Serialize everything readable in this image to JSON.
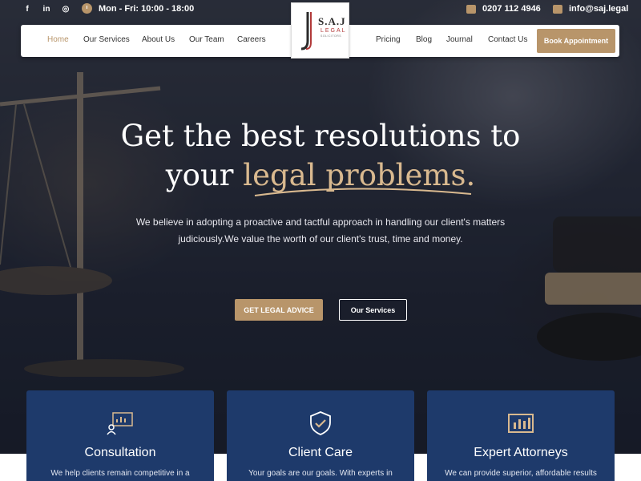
{
  "topbar": {
    "hours": "Mon - Fri: 10:00 - 18:00",
    "phone": "0207 112 4946",
    "email": "info@saj.legal",
    "social": [
      "facebook-icon",
      "linkedin-icon",
      "instagram-icon"
    ]
  },
  "logo": {
    "name": "S.A.J",
    "line1": "LEGAL",
    "line2": "SOLICITORS"
  },
  "nav": {
    "left": [
      "Home",
      "Our Services",
      "About Us",
      "Our Team",
      "Careers"
    ],
    "right": [
      "Pricing",
      "Blog",
      "Journal",
      "Contact Us"
    ],
    "book": "Book Appointment",
    "active": "Home"
  },
  "hero": {
    "line1": "Get the best resolutions to",
    "line2_plain": "your",
    "line2_accent": "legal problems.",
    "subtext": "We believe in adopting a proactive and tactful approach in handling our client's matters judiciously.We value the worth of our client's trust, time and money.",
    "cta_primary": "GET LEGAL ADVICE",
    "cta_secondary": "Our Services"
  },
  "cards": [
    {
      "title": "Consultation",
      "text": "We help clients remain competitive in a",
      "icon": "presentation-icon"
    },
    {
      "title": "Client Care",
      "text": "Your goals are our goals. With experts in",
      "icon": "shield-check-icon"
    },
    {
      "title": "Expert Attorneys",
      "text": "We can provide superior, affordable results",
      "icon": "bar-chart-icon"
    }
  ],
  "colors": {
    "accent": "#b8956a",
    "card": "#1e3a6b",
    "headline_accent": "#d9b98f"
  }
}
